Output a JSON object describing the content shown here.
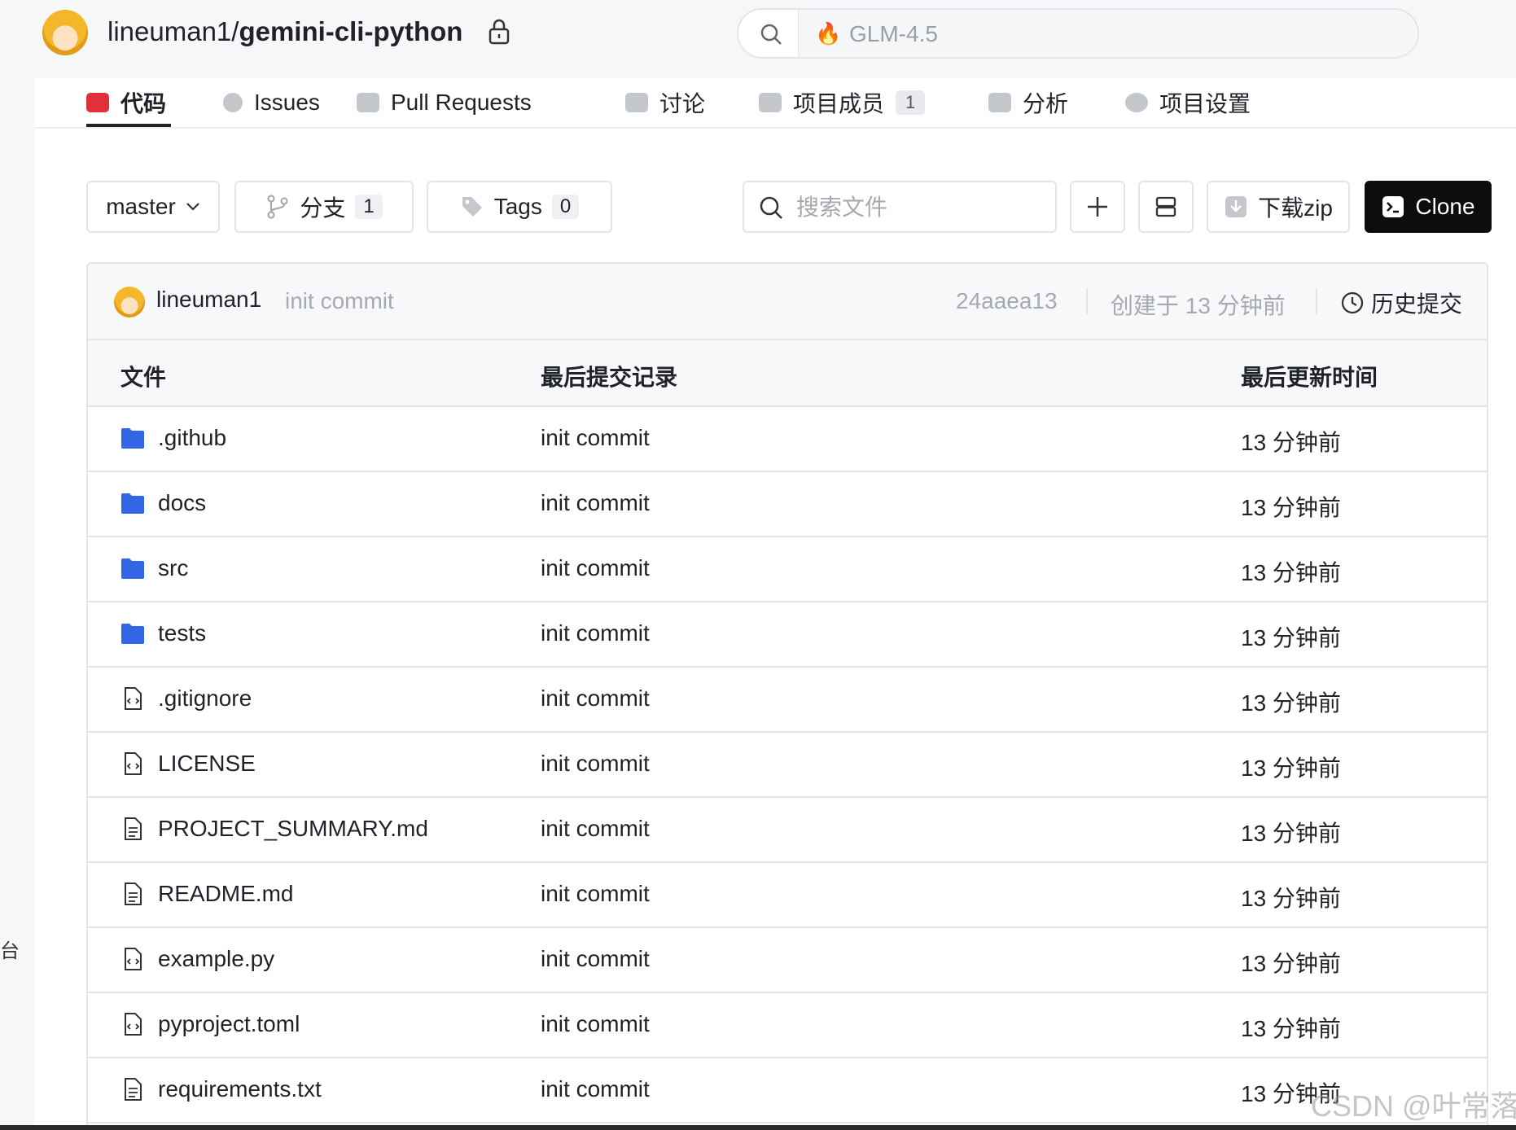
{
  "repo": {
    "owner": "lineuman1/",
    "name": "gemini-cli-python"
  },
  "global_search": {
    "placeholder": "GLM-4.5"
  },
  "tabs": [
    {
      "label": "代码",
      "count": ""
    },
    {
      "label": "Issues",
      "count": ""
    },
    {
      "label": "Pull Requests",
      "count": ""
    },
    {
      "label": "讨论",
      "count": ""
    },
    {
      "label": "项目成员",
      "count": "1"
    },
    {
      "label": "分析",
      "count": ""
    },
    {
      "label": "项目设置",
      "count": ""
    }
  ],
  "toolbar": {
    "branch": "master",
    "branches_label": "分支",
    "branches_count": "1",
    "tags_label": "Tags",
    "tags_count": "0",
    "file_search_placeholder": "搜索文件",
    "download_label": "下载zip",
    "clone_label": "Clone"
  },
  "commit": {
    "author": "lineuman1",
    "message": "init commit",
    "hash": "24aaea13",
    "created": "创建于 13 分钟前",
    "history_label": "历史提交"
  },
  "table": {
    "headers": [
      "文件",
      "最后提交记录",
      "最后更新时间"
    ],
    "rows": [
      {
        "name": ".github",
        "type": "folder",
        "commit": "init commit",
        "time": "13 分钟前"
      },
      {
        "name": "docs",
        "type": "folder",
        "commit": "init commit",
        "time": "13 分钟前"
      },
      {
        "name": "src",
        "type": "folder",
        "commit": "init commit",
        "time": "13 分钟前"
      },
      {
        "name": "tests",
        "type": "folder",
        "commit": "init commit",
        "time": "13 分钟前"
      },
      {
        "name": ".gitignore",
        "type": "code-file",
        "commit": "init commit",
        "time": "13 分钟前"
      },
      {
        "name": "LICENSE",
        "type": "code-file",
        "commit": "init commit",
        "time": "13 分钟前"
      },
      {
        "name": "PROJECT_SUMMARY.md",
        "type": "text-file",
        "commit": "init commit",
        "time": "13 分钟前"
      },
      {
        "name": "README.md",
        "type": "text-file",
        "commit": "init commit",
        "time": "13 分钟前"
      },
      {
        "name": "example.py",
        "type": "code-file",
        "commit": "init commit",
        "time": "13 分钟前"
      },
      {
        "name": "pyproject.toml",
        "type": "code-file",
        "commit": "init commit",
        "time": "13 分钟前"
      },
      {
        "name": "requirements.txt",
        "type": "text-file",
        "commit": "init commit",
        "time": "13 分钟前"
      }
    ]
  },
  "watermark": "CSDN @叶常落",
  "left_glyph": "台",
  "colors": {
    "folder": "#3366e6",
    "active_tab_icon": "#e0303a",
    "clone_bg": "#0d0d0d"
  }
}
